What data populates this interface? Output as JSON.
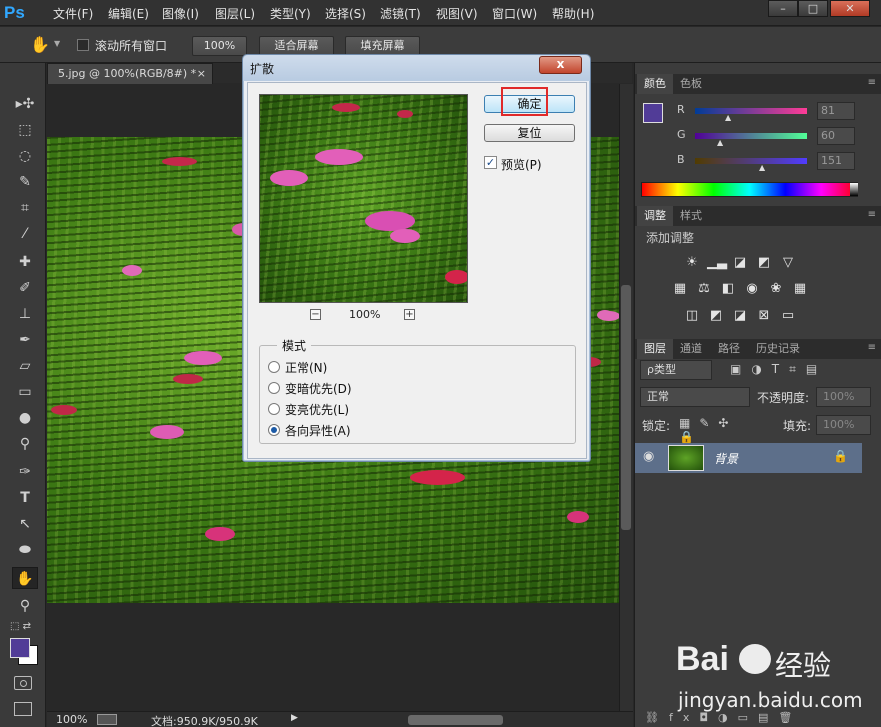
{
  "menu": {
    "logo": "Ps",
    "items": [
      "文件(F)",
      "编辑(E)",
      "图像(I)",
      "图层(L)",
      "类型(Y)",
      "选择(S)",
      "滤镜(T)",
      "视图(V)",
      "窗口(W)",
      "帮助(H)"
    ],
    "window_controls": [
      "–",
      "□",
      "✕"
    ]
  },
  "options_bar": {
    "scroll_all_label": "滚动所有窗口",
    "zoom_100": "100%",
    "fit_screen": "适合屏幕",
    "fill_screen": "填充屏幕"
  },
  "document": {
    "tab_title": "5.jpg @ 100%(RGB/8#) *",
    "tab_close": "×"
  },
  "status": {
    "zoom": "100%",
    "doc_info": "文档:950.9K/950.9K"
  },
  "color_panel": {
    "tabs": [
      "颜色",
      "色板"
    ],
    "labels": [
      "R",
      "G",
      "B"
    ],
    "values": [
      "81",
      "60",
      "151"
    ],
    "foreground": "#513c97"
  },
  "adjustments_panel": {
    "tabs": [
      "调整",
      "样式"
    ],
    "title": "添加调整"
  },
  "layers_panel": {
    "tabs": [
      "图层",
      "通道",
      "路径",
      "历史记录"
    ],
    "filter_kind": "ρ类型",
    "blend_mode": "正常",
    "opacity_label": "不透明度:",
    "opacity_value": "100%",
    "lock_label": "锁定:",
    "fill_label": "填充:",
    "fill_value": "100%",
    "layer_name": "背景"
  },
  "dialog": {
    "title": "扩散",
    "close": "x",
    "ok": "确定",
    "reset": "复位",
    "preview_label": "预览(P)",
    "preview_checked": true,
    "zoom": "100%",
    "zoom_out": "−",
    "zoom_in": "+",
    "mode_legend": "模式",
    "modes": [
      "正常(N)",
      "变暗优先(D)",
      "变亮优先(L)",
      "各向异性(A)"
    ],
    "selected_mode": 3
  },
  "watermark": {
    "brand": "Bai",
    "brand_cn": "经验",
    "url": "jingyan.baidu.com"
  }
}
